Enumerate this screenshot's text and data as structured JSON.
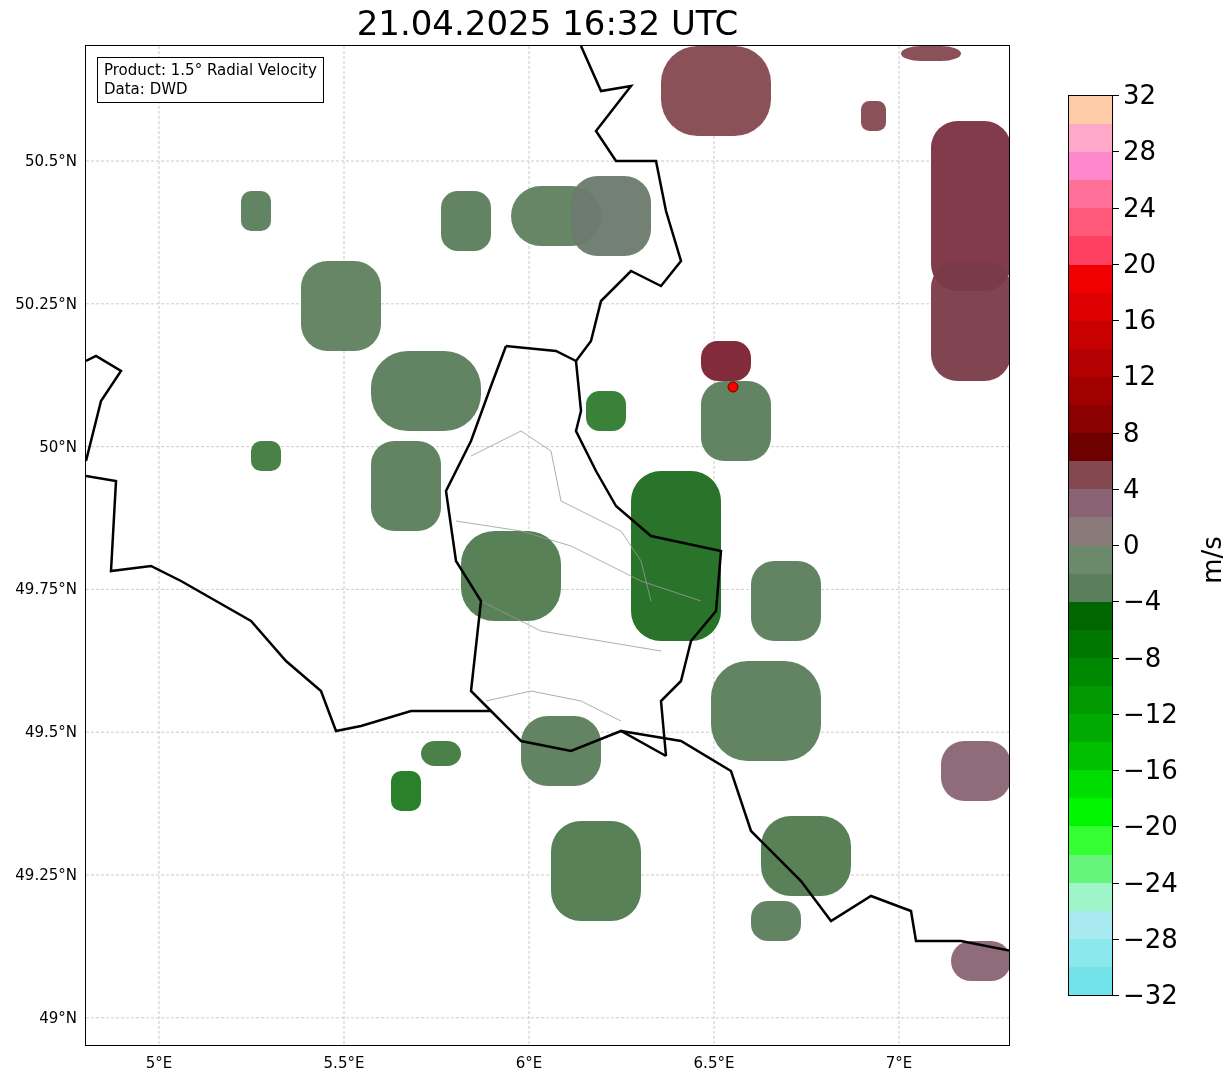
{
  "title": "21.04.2025 16:32 UTC",
  "info_box": {
    "lines": [
      "Product: 1.5° Radial Velocity",
      "Data: DWD"
    ]
  },
  "x_ticks": [
    "5°E",
    "5.5°E",
    "6°E",
    "6.5°E",
    "7°E"
  ],
  "y_ticks": [
    "50.5°N",
    "50.25°N",
    "50°N",
    "49.75°N",
    "49.5°N",
    "49.25°N",
    "49°N"
  ],
  "colorbar": {
    "label": "m/s",
    "ticks": [
      "32",
      "28",
      "24",
      "20",
      "16",
      "12",
      "8",
      "4",
      "0",
      "−4",
      "−8",
      "−12",
      "−16",
      "−20",
      "−24",
      "−28",
      "−32"
    ],
    "bands": [
      {
        "color": "#ffccaa"
      },
      {
        "color": "#ffa8c8"
      },
      {
        "color": "#ff88cc"
      },
      {
        "color": "#ff7098"
      },
      {
        "color": "#ff5a7a"
      },
      {
        "color": "#ff4060"
      },
      {
        "color": "#f00000"
      },
      {
        "color": "#dc0000"
      },
      {
        "color": "#c80000"
      },
      {
        "color": "#b40000"
      },
      {
        "color": "#a00000"
      },
      {
        "color": "#8b0000"
      },
      {
        "color": "#6e0000"
      },
      {
        "color": "#844850"
      },
      {
        "color": "#8a6474"
      },
      {
        "color": "#8a7a7a"
      },
      {
        "color": "#6b8a6b"
      },
      {
        "color": "#5a7d5a"
      },
      {
        "color": "#006600"
      },
      {
        "color": "#007700"
      },
      {
        "color": "#008800"
      },
      {
        "color": "#009900"
      },
      {
        "color": "#00aa00"
      },
      {
        "color": "#00c000"
      },
      {
        "color": "#00dd00"
      },
      {
        "color": "#00f500"
      },
      {
        "color": "#33ff33"
      },
      {
        "color": "#66f57a"
      },
      {
        "color": "#9ef5c8"
      },
      {
        "color": "#a8eaf0"
      },
      {
        "color": "#8be9ee"
      },
      {
        "color": "#72e3e8"
      }
    ]
  }
}
